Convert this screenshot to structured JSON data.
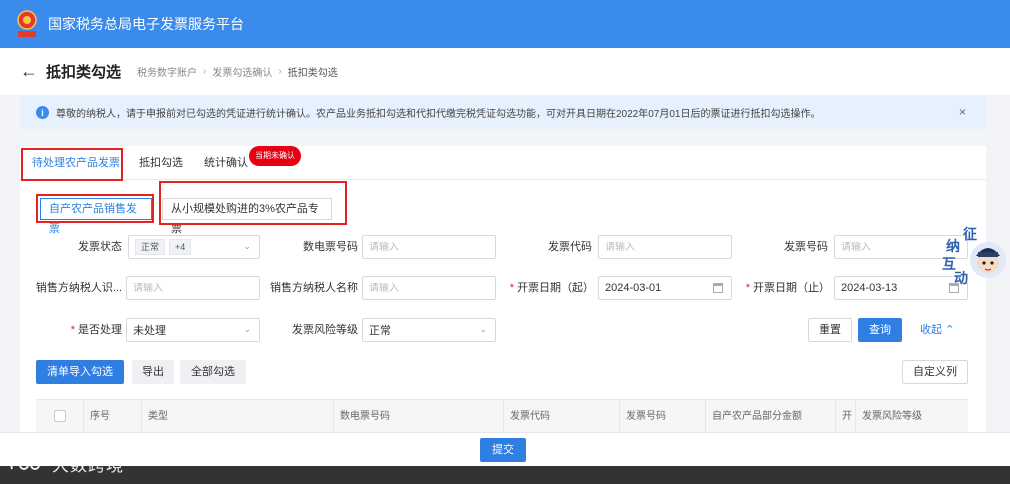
{
  "header": {
    "app_title": "国家税务总局电子发票服务平台",
    "emblem_text": "税务总局"
  },
  "subheader": {
    "page_title": "抵扣类勾选",
    "breadcrumb": [
      "税务数字账户",
      "发票勾选确认",
      "抵扣类勾选"
    ]
  },
  "notice": {
    "text": "尊敬的纳税人，请于申报前对已勾选的凭证进行统计确认。农产品业务抵扣勾选和代扣代缴完税凭证勾选功能，可对开具日期在2022年07月01日后的票证进行抵扣勾选操作。",
    "close": "×"
  },
  "tabs": [
    {
      "label": "待处理农产品发票",
      "active": true
    },
    {
      "label": "抵扣勾选",
      "active": false
    },
    {
      "label": "统计确认",
      "active": false
    }
  ],
  "tab_badge": "当期未确认",
  "subtabs": [
    {
      "label": "自产农产品销售发票",
      "active": true
    },
    {
      "label": "从小规模处购进的3%农产品专票",
      "active": false
    }
  ],
  "filters": {
    "invoice_status": {
      "label": "发票状态",
      "tag": "正常",
      "more": "+4"
    },
    "digital_invoice_no": {
      "label": "数电票号码",
      "placeholder": "请输入"
    },
    "invoice_code": {
      "label": "发票代码",
      "placeholder": "请输入"
    },
    "invoice_no": {
      "label": "发票号码",
      "placeholder": "请输入"
    },
    "seller_tax_id": {
      "label": "销售方纳税人识...",
      "placeholder": "请输入"
    },
    "seller_name": {
      "label": "销售方纳税人名称",
      "placeholder": "请输入"
    },
    "date_start": {
      "label": "开票日期（起）",
      "value": "2024-03-01"
    },
    "date_end": {
      "label": "开票日期（止）",
      "value": "2024-03-13"
    },
    "processed": {
      "label": "是否处理",
      "value": "未处理"
    },
    "risk_level": {
      "label": "发票风险等级",
      "value": "正常"
    }
  },
  "buttons": {
    "reset": "重置",
    "query": "查询",
    "collapse": "收起",
    "import_select": "清单导入勾选",
    "export": "导出",
    "select_all": "全部勾选",
    "custom_columns": "自定义列",
    "submit": "提交"
  },
  "table": {
    "columns": [
      "序号",
      "类型",
      "数电票号码",
      "发票代码",
      "发票号码",
      "自产农产品部分金额",
      "开",
      "发票风险等级"
    ]
  },
  "assistant": {
    "chars": [
      "征",
      "纳",
      "互",
      "动"
    ]
  },
  "watermark": "大数跨境",
  "colors": {
    "primary": "#2f7fe3",
    "header": "#3b8bec",
    "highlight_box": "#e52222",
    "badge": "#e60012"
  }
}
